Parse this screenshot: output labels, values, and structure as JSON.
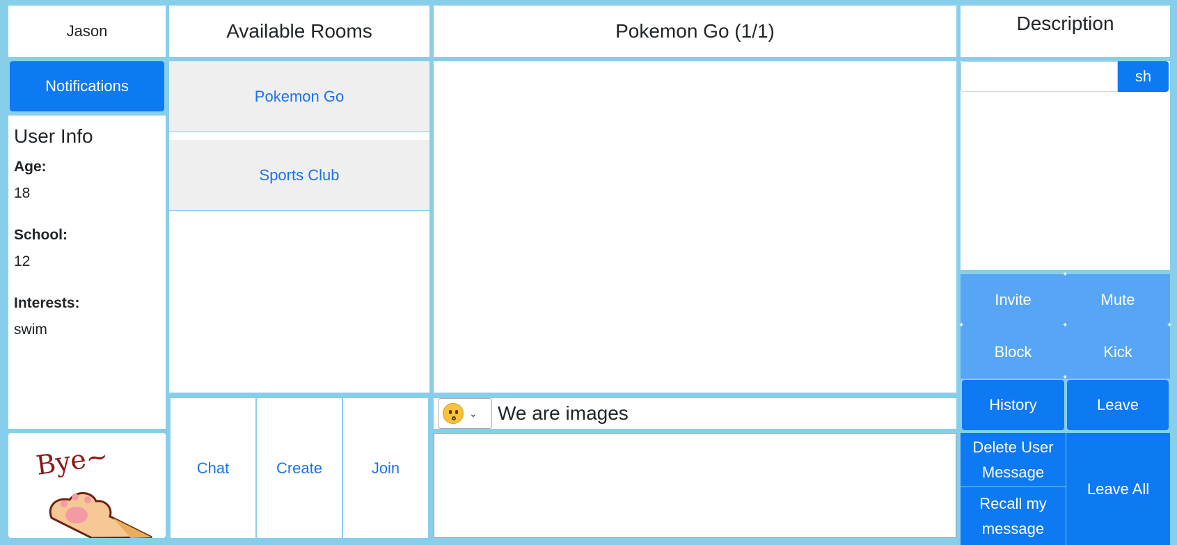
{
  "user": {
    "name": "Jason"
  },
  "left": {
    "notifications_label": "Notifications",
    "user_info_title": "User Info",
    "fields": [
      {
        "label": "Age:",
        "value": "18"
      },
      {
        "label": "School:",
        "value": "12"
      },
      {
        "label": "Interests:",
        "value": "swim"
      }
    ],
    "sticker_text": "Bye~"
  },
  "rooms": {
    "title": "Available Rooms",
    "items": [
      {
        "label": "Pokemon Go"
      },
      {
        "label": "Sports Club"
      }
    ],
    "actions": {
      "chat": "Chat",
      "create": "Create",
      "join": "Join"
    }
  },
  "chat": {
    "title": "Pokemon Go (1/1)",
    "emoji_note": "We are images",
    "message_value": ""
  },
  "description": {
    "title": "Description",
    "search_value": "",
    "search_button": "sh"
  },
  "controls": {
    "invite": "Invite",
    "mute": "Mute",
    "block": "Block",
    "kick": "Kick",
    "history": "History",
    "leave": "Leave",
    "delete_user_message": "Delete User Message",
    "recall_my_message": "Recall my message",
    "leave_all": "Leave All"
  },
  "colors": {
    "border": "#87ceeb",
    "primary": "#0d79f2",
    "primary_light": "#57a5f5",
    "link": "#1a73e8",
    "room_bg": "#efefef"
  }
}
